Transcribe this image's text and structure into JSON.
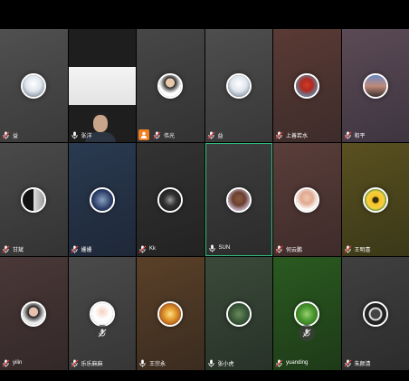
{
  "participants": [
    {
      "name": "益",
      "mic": "muted",
      "bg": "linear-gradient(160deg,#505050,#3a3a3a)",
      "avatar": "radial-gradient(circle at 50% 40%,#ffffff 0,#dfe6ee 45%,#5c6a7a 100%)",
      "icon": "avatar-icon"
    },
    {
      "name": "张洋",
      "mic": "on",
      "video": true,
      "bg": "#1e1e1e",
      "icon": "camera-feed"
    },
    {
      "name": "伟光",
      "mic": "muted",
      "host": true,
      "bg": "linear-gradient(160deg,#474747,#323232)",
      "avatar": "radial-gradient(circle at 50% 35%,#e8c8a8 0,#e8c8a8 25%,#222 26%,#fff 60%)",
      "icon": "avatar-icon"
    },
    {
      "name": "益",
      "mic": "muted",
      "bg": "linear-gradient(160deg,#4e4e4e,#383838)",
      "avatar": "radial-gradient(circle at 50% 40%,#ffffff 0,#dfe6ee 45%,#5c6a7a 100%)",
      "icon": "avatar-icon"
    },
    {
      "name": "上善若水",
      "mic": "muted",
      "bg": "linear-gradient(160deg,#5a3a34,#3d2c2a)",
      "avatar": "radial-gradient(circle at 50% 45%,#d43a2a 0,#b02a20 35%,#6a7f98 70%)",
      "icon": "avatar-icon"
    },
    {
      "name": "和平",
      "mic": "muted",
      "bg": "linear-gradient(160deg,#5b4a55,#3e3540)",
      "avatar": "linear-gradient(180deg,#6a88c4 0,#c08a7a 50%,#3a3030 100%)",
      "icon": "avatar-icon"
    },
    {
      "name": "甘斌",
      "mic": "muted",
      "bg": "linear-gradient(160deg,#4a4a4a,#333)",
      "avatar": "linear-gradient(90deg,#111 0,#111 50%,#ddd 50%,#999 100%)",
      "icon": "avatar-icon"
    },
    {
      "name": "姗姗",
      "mic": "muted",
      "bg": "linear-gradient(160deg,#2a3a50,#1e2838)",
      "avatar": "radial-gradient(circle,#8aa0c0 0,#2a3c66 60%,#1a223a 100%)",
      "icon": "avatar-icon"
    },
    {
      "name": "Kk",
      "mic": "muted",
      "bg": "linear-gradient(160deg,#333,#222)",
      "avatar": "radial-gradient(circle,#999 0,#333 40%,#111 100%)",
      "icon": "avatar-icon"
    },
    {
      "name": "SUN",
      "mic": "on",
      "speaking": true,
      "bg": "linear-gradient(160deg,#3e3e3e,#2b2b2b)",
      "avatar": "radial-gradient(circle at 50% 45%,#8a5a40 0,#6a4030 40%,#cfc0d8 75%)",
      "icon": "avatar-icon"
    },
    {
      "name": "何云鹏",
      "mic": "muted",
      "bg": "linear-gradient(160deg,#5a3e3a,#3e2b2a)",
      "avatar": "radial-gradient(circle at 50% 40%,#f0c8b0 0,#e0a890 35%,#fff 70%)",
      "icon": "avatar-icon"
    },
    {
      "name": "王明喜",
      "mic": "muted",
      "bg": "linear-gradient(160deg,#5a5020,#3a3818)",
      "avatar": "radial-gradient(circle,#3a2a10 0,#3a2a10 20%,#f0c020 22%,#f8d040 55%,#4a8a30 75%)",
      "icon": "avatar-icon"
    },
    {
      "name": "yilin",
      "mic": "muted",
      "bg": "linear-gradient(160deg,#4a3838,#332828)",
      "avatar": "radial-gradient(circle at 50% 40%,#e8c0b0 0,#e8c0b0 25%,#222 30%,#eee 65%)",
      "icon": "avatar-icon"
    },
    {
      "name": "乐乐麻麻",
      "mic": "muted",
      "overlayMic": true,
      "bg": "linear-gradient(160deg,#4a4a4a,#363636)",
      "avatar": "radial-gradient(circle at 50% 40%,#f5d0c0 0,#fff 45%,#f0f0f0 100%)",
      "icon": "avatar-icon"
    },
    {
      "name": "王宗永",
      "mic": "on",
      "bg": "linear-gradient(160deg,#5a4028,#3a2c20)",
      "avatar": "radial-gradient(circle,#f8e090 0,#e8a030 35%,#b06020 70%)",
      "icon": "avatar-icon"
    },
    {
      "name": "张小虎",
      "mic": "on",
      "bg": "linear-gradient(160deg,#3a4a3a,#283228)",
      "avatar": "radial-gradient(circle,#6a8a5a 0,#3a5a3a 50%,#203020 100%)",
      "icon": "avatar-icon"
    },
    {
      "name": "yuanding",
      "mic": "muted",
      "overlayMic": true,
      "bg": "linear-gradient(160deg,#2a5a20,#1e3a18)",
      "avatar": "radial-gradient(circle,#9ad070 0,#4a9a30 45%,#2a5a18 100%)",
      "icon": "avatar-icon"
    },
    {
      "name": "朱颜清",
      "mic": "muted",
      "bg": "linear-gradient(160deg,#404040,#2c2c2c)",
      "avatar": "radial-gradient(circle,#444 0,#444 30%,#ddd 34%,#ddd 42%,#222 46%)",
      "icon": "avatar-icon"
    }
  ],
  "colors": {
    "mic_on": "#ffffff",
    "mic_muted": "#e04040",
    "speaking_border": "#2ec27e",
    "host_badge": "#f08020"
  }
}
